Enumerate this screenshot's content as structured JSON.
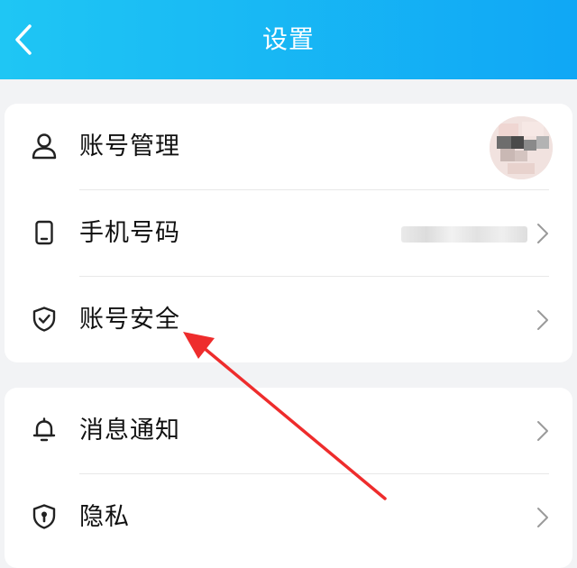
{
  "header": {
    "title": "设置",
    "back_icon": "chevron-left-icon",
    "gradient_start": "#1fc6f4",
    "gradient_end": "#10a7f5"
  },
  "sections": [
    {
      "items": [
        {
          "label": "账号管理",
          "icon": "user-icon",
          "trailing": "avatar"
        },
        {
          "label": "手机号码",
          "icon": "phone-icon",
          "trailing": "masked-value-chevron"
        },
        {
          "label": "账号安全",
          "icon": "shield-check-icon",
          "trailing": "chevron"
        }
      ]
    },
    {
      "items": [
        {
          "label": "消息通知",
          "icon": "bell-icon",
          "trailing": "chevron"
        },
        {
          "label": "隐私",
          "icon": "shield-lock-icon",
          "trailing": "chevron"
        }
      ]
    }
  ],
  "annotation": {
    "type": "arrow",
    "color": "#ee2c2c",
    "points_to": "账号安全"
  },
  "colors": {
    "background": "#f2f3f5",
    "card": "#ffffff",
    "text": "#111111",
    "chevron": "#9a9a9a"
  }
}
